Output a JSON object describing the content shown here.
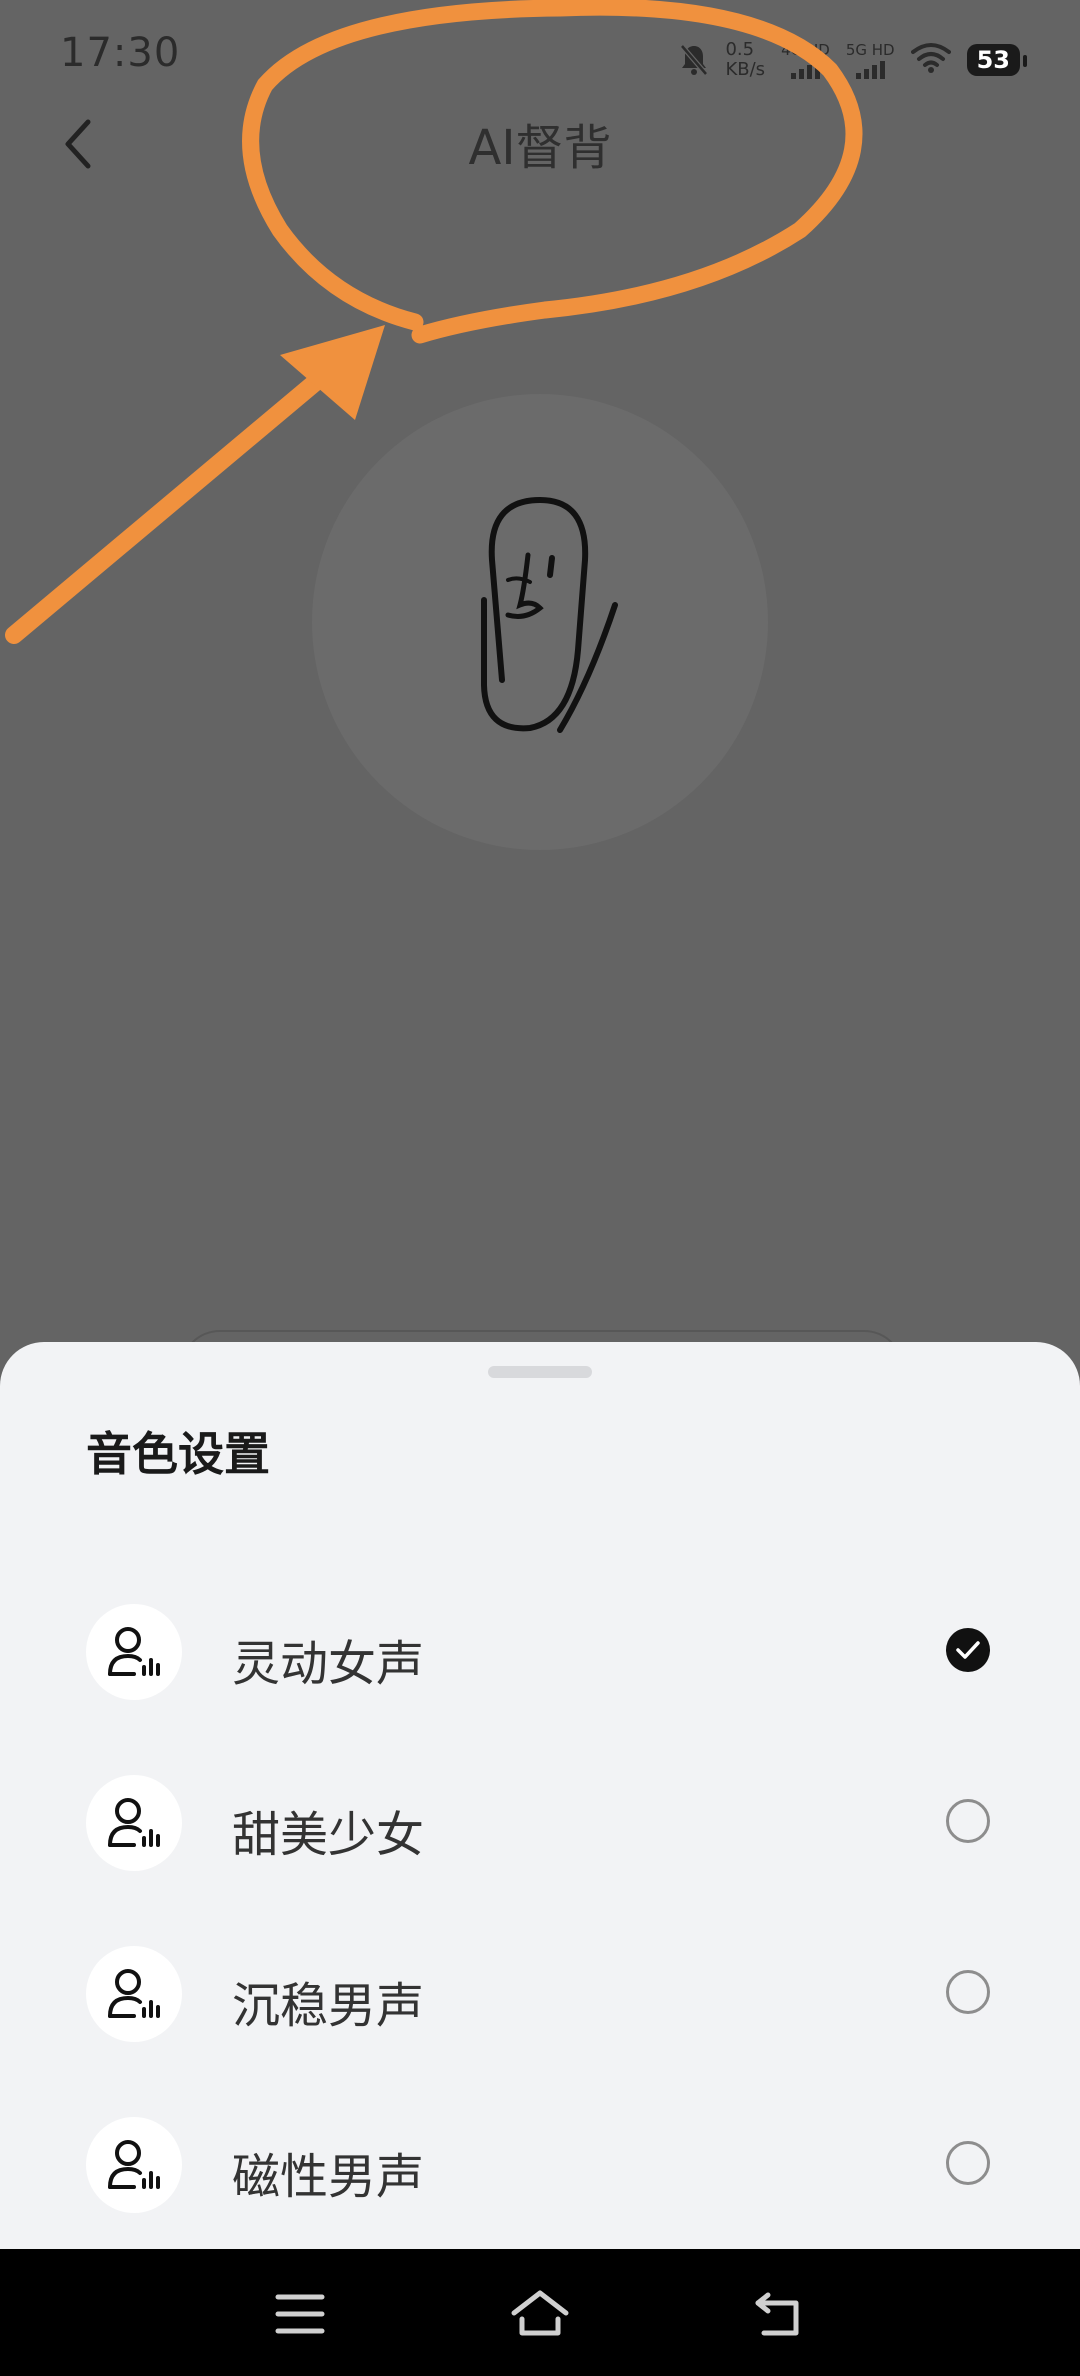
{
  "status_bar": {
    "time": "17:30",
    "net_speed_value": "0.5",
    "net_speed_unit": "KB/s",
    "sim1_label": "4G HD",
    "sim2_label": "5G HD",
    "battery": "53"
  },
  "header": {
    "back_icon": "chevron-left-icon",
    "title": "AI督背"
  },
  "mascot": {
    "icon": "paperclip-face-icon"
  },
  "voice_sheet": {
    "title": "音色设置",
    "options": [
      {
        "label": "灵动女声",
        "selected": true
      },
      {
        "label": "甜美少女",
        "selected": false
      },
      {
        "label": "沉稳男声",
        "selected": false
      },
      {
        "label": "磁性男声",
        "selected": false
      }
    ]
  },
  "system_nav": {
    "menu_icon": "menu-icon",
    "home_icon": "home-icon",
    "back_icon": "back-arrow-icon"
  },
  "colors": {
    "overlay": "#646464",
    "sheet_bg": "#f2f3f5",
    "annotation": "#f0913e",
    "check": "#111111"
  }
}
